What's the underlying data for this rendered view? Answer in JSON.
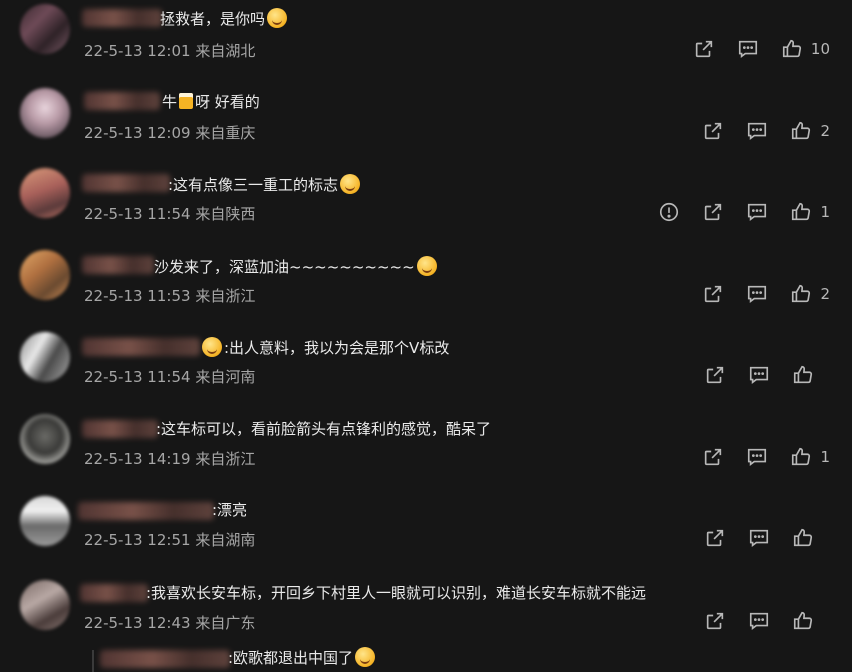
{
  "comments": [
    {
      "text": "拯救者，是你吗",
      "emoji": "smile",
      "time": "22-5-13 12:01",
      "location": "来自湖北",
      "likes": "10",
      "report": false
    },
    {
      "text_pre": "牛",
      "text": "呀 好看的",
      "emoji": null,
      "beer": true,
      "time": "22-5-13 12:09",
      "location": "来自重庆",
      "likes": "2",
      "report": false
    },
    {
      "text": ":这有点像三一重工的标志",
      "emoji": "tongue",
      "time": "22-5-13 11:54",
      "location": "来自陕西",
      "likes": "1",
      "report": true
    },
    {
      "text": "沙发来了，深蓝加油~~~~~~~~~~",
      "emoji": "laugh",
      "time": "22-5-13 11:53",
      "location": "来自浙江",
      "likes": "2",
      "report": false
    },
    {
      "text": ":出人意料，我以为会是那个V标改",
      "emoji": "love",
      "emoji_first": true,
      "time": "22-5-13 11:54",
      "location": "来自河南",
      "likes": "",
      "report": false
    },
    {
      "text": ":这车标可以，看前脸箭头有点锋利的感觉，酷呆了",
      "emoji": null,
      "time": "22-5-13 14:19",
      "location": "来自浙江",
      "likes": "1",
      "report": false
    },
    {
      "text": ":漂亮",
      "emoji": null,
      "time": "22-5-13 12:51",
      "location": "来自湖南",
      "likes": "",
      "report": false
    },
    {
      "text": ":我喜欢长安车标，开回乡下村里人一眼就可以识别，难道长安车标就不能远",
      "emoji": null,
      "time": "22-5-13 12:43",
      "location": "来自广东",
      "likes": "",
      "report": false,
      "truncated": true
    }
  ],
  "reply": {
    "text": ":欧歌都退出中国了",
    "emoji": "smile"
  },
  "icons": {
    "share": "share-icon",
    "comment": "comment-icon",
    "like": "thumb-up-icon",
    "report": "report-icon"
  }
}
